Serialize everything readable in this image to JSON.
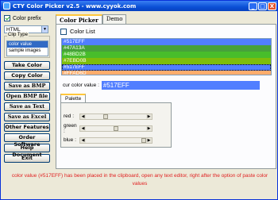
{
  "window": {
    "title": "CTY Color Picker v2.5 - www.cyyok.com",
    "minimize": "_",
    "maximize": "□",
    "close": "X"
  },
  "left": {
    "color_prefix_label": "Color prefix",
    "color_prefix_checked": true,
    "prefix_value": "HTML",
    "clip_type_legend": "Clip Type",
    "clip_items": [
      "color value",
      "sample images"
    ],
    "clip_selected": 0,
    "buttons": [
      "Take Color",
      "Copy Color",
      "Save as BMP",
      "Open BMP file",
      "Save as Text",
      "Save as Excel",
      "Other Features",
      "Order Software",
      "Help Document",
      "Exit"
    ]
  },
  "tabs": [
    "Color Picker",
    "Demo"
  ],
  "active_tab": 0,
  "colorlist": {
    "label": "Color List",
    "checked": false,
    "items": [
      {
        "text": "#517EFF",
        "color": "#517EFF"
      },
      {
        "text": "#47A13A",
        "color": "#47A13A"
      },
      {
        "text": "#48BD2B",
        "color": "#48BD2B"
      },
      {
        "text": "#7EBD0B",
        "color": "#7EBD0B"
      },
      {
        "text": "#517EFF",
        "color": "#517EFF"
      },
      {
        "text": "#FFAD6D",
        "color": "#FFAD6D"
      }
    ],
    "selected_index": 4
  },
  "current": {
    "label": "cur color value :",
    "value": "#517EFF",
    "color": "#517EFF"
  },
  "palette": {
    "tab_label": "Palette",
    "sliders": [
      {
        "label": "red :",
        "value": 81
      },
      {
        "label": "green :",
        "value": 126
      },
      {
        "label": "blue :",
        "value": 255
      }
    ],
    "max": 255
  },
  "status": {
    "message": "color value (#517EFF) has been placed in the clipboard, open any text editor, right after the option of paste color values",
    "color": "#E02020"
  }
}
